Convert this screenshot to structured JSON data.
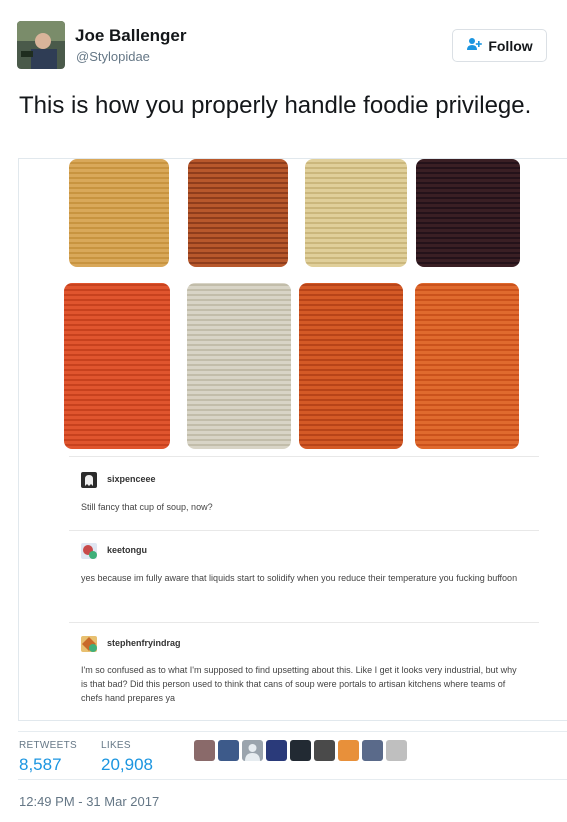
{
  "author": {
    "name": "Joe Ballenger",
    "handle": "@Stylopidae",
    "follow_label": "Follow"
  },
  "tweet": {
    "text": "This is how you properly handle foodie privilege."
  },
  "media": {
    "comments": [
      {
        "user": "sixpenceee",
        "text": "Still fancy that cup of soup, now?"
      },
      {
        "user": "keetongu",
        "text": "yes because im fully aware that liquids start to solidify when you reduce their temperature you fucking buffoon"
      },
      {
        "user": "stephenfryindrag",
        "text": "I'm so confused as to what I'm supposed to find upsetting about this. Like I get it looks very industrial, but why is that bad? Did this person used to think that cans of soup were portals to artisan kitchens where teams of chefs hand prepares ya"
      }
    ]
  },
  "stats": {
    "retweets_label": "RETWEETS",
    "retweets_value": "8,587",
    "likes_label": "LIKES",
    "likes_value": "20,908"
  },
  "timestamp": "12:49 PM - 31 Mar 2017",
  "colors": {
    "link_blue": "#1b95e0",
    "muted": "#657786"
  }
}
